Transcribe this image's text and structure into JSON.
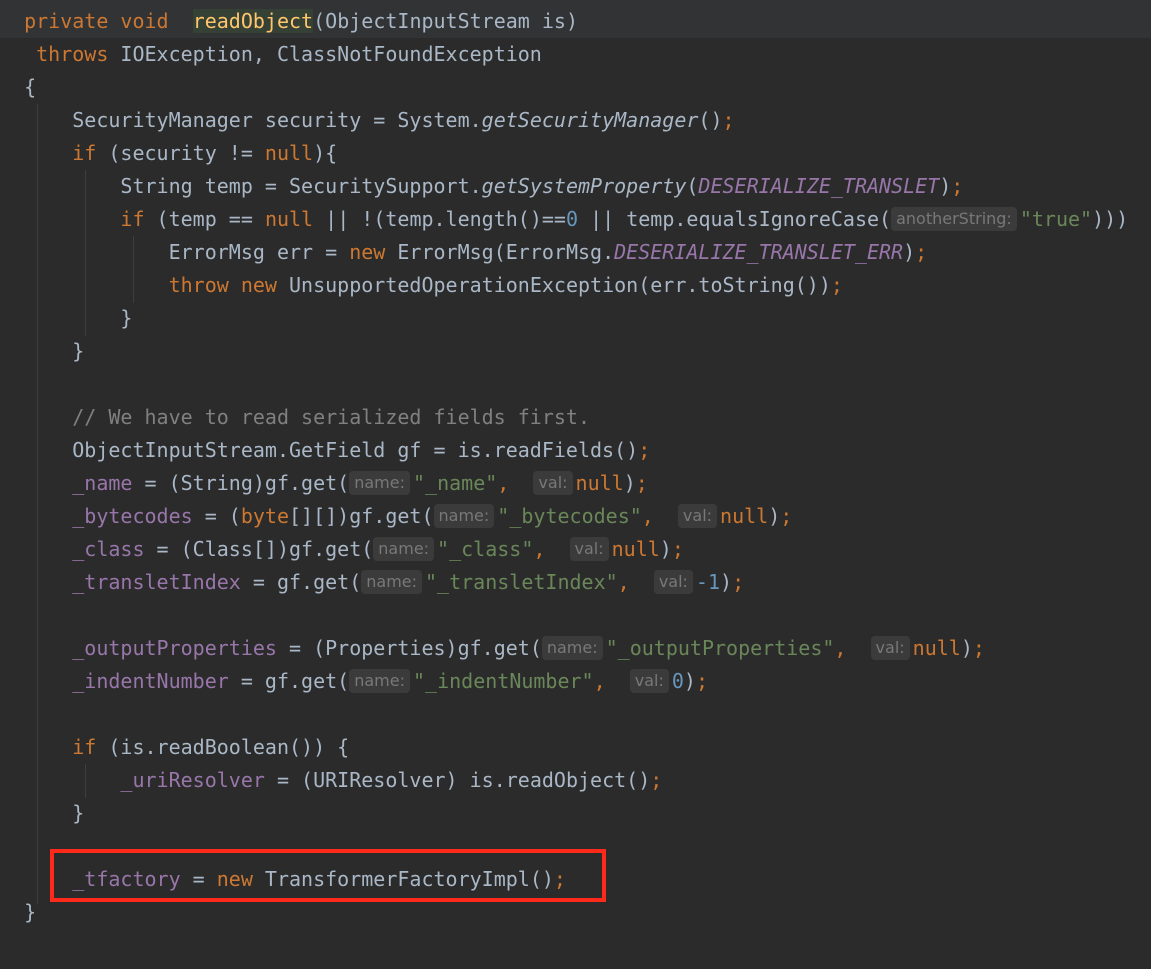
{
  "code": {
    "l1": {
      "kw": "private void",
      "method": "readObject",
      "rest": "(ObjectInputStream is)"
    },
    "l2": {
      "kw": "throws",
      "rest": " IOException, ClassNotFoundException"
    },
    "l3": {
      "brace": "{"
    },
    "l4": {
      "a": "SecurityManager security = System.",
      "call": "getSecurityManager",
      "b": "()",
      "semi": ";"
    },
    "l5": {
      "kw": "if",
      "a": " (security != ",
      "null": "null",
      "b": "){"
    },
    "l6": {
      "a": "String temp = SecuritySupport.",
      "call": "getSystemProperty",
      "b": "(",
      "const": "DESERIALIZE_TRANSLET",
      "c": ")",
      "semi": ";"
    },
    "l7": {
      "kw": "if",
      "a": " (temp == ",
      "null": "null",
      "b": " || !(temp.length()==",
      "zero": "0",
      "c": " || temp.equalsIgnoreCase(",
      "hint": "anotherString:",
      "str": "\"true\"",
      "d": ")))"
    },
    "l8": {
      "a": "ErrorMsg err = ",
      "kw": "new",
      "b": " ErrorMsg(ErrorMsg.",
      "const": "DESERIALIZE_TRANSLET_ERR",
      "c": ")",
      "semi": ";"
    },
    "l9": {
      "kw1": "throw",
      "kw2": "new",
      "a": " UnsupportedOperationException(err.toString())",
      "semi": ";"
    },
    "l10": {
      "brace": "}"
    },
    "l11": {
      "brace": "}"
    },
    "l12": {
      "comment": "// We have to read serialized fields first."
    },
    "l13": {
      "a": "ObjectInputStream.GetField gf = is.readFields()",
      "semi": ";"
    },
    "l14": {
      "field": "_name",
      "a": " = (String)gf.get(",
      "hint1": "name:",
      "str": "\"_name\"",
      "comma": ",",
      "hint2": "val:",
      "val": "null",
      "b": ")",
      "semi": ";"
    },
    "l15": {
      "field": "_bytecodes",
      "a": " = (",
      "kw": "byte",
      "b": "[][])gf.get(",
      "hint1": "name:",
      "str": "\"_bytecodes\"",
      "comma": ",",
      "hint2": "val:",
      "val": "null",
      "c": ")",
      "semi": ";"
    },
    "l16": {
      "field": "_class",
      "a": " = (Class[])gf.get(",
      "hint1": "name:",
      "str": "\"_class\"",
      "comma": ",",
      "hint2": "val:",
      "val": "null",
      "b": ")",
      "semi": ";"
    },
    "l17": {
      "field": "_transletIndex",
      "a": " = gf.get(",
      "hint1": "name:",
      "str": "\"_transletIndex\"",
      "comma": ",",
      "hint2": "val:",
      "val": "-1",
      "b": ")",
      "semi": ";"
    },
    "l18": {
      "field": "_outputProperties",
      "a": " = (Properties)gf.get(",
      "hint1": "name:",
      "str": "\"_outputProperties\"",
      "comma": ",",
      "hint2": "val:",
      "val": "null",
      "b": ")",
      "semi": ";"
    },
    "l19": {
      "field": "_indentNumber",
      "a": " = gf.get(",
      "hint1": "name:",
      "str": "\"_indentNumber\"",
      "comma": ",",
      "hint2": "val:",
      "val": "0",
      "b": ")",
      "semi": ";"
    },
    "l20": {
      "kw": "if",
      "a": " (is.readBoolean()) {"
    },
    "l21": {
      "field": "_uriResolver",
      "a": " = (URIResolver) is.readObject()",
      "semi": ";"
    },
    "l22": {
      "brace": "}"
    },
    "l23": {
      "field": "_tfactory",
      "a": " = ",
      "kw": "new",
      "b": " TransformerFactoryImpl()",
      "semi": ";"
    },
    "l24": {
      "brace": "}"
    }
  },
  "colors": {
    "background": "#2b2b2b",
    "keyword": "#cc7832",
    "method_declaration": "#ffc66d",
    "field": "#9876aa",
    "string": "#6a8759",
    "number": "#6897bb",
    "comment": "#808080",
    "highlight_box": "#ff2a1a"
  }
}
